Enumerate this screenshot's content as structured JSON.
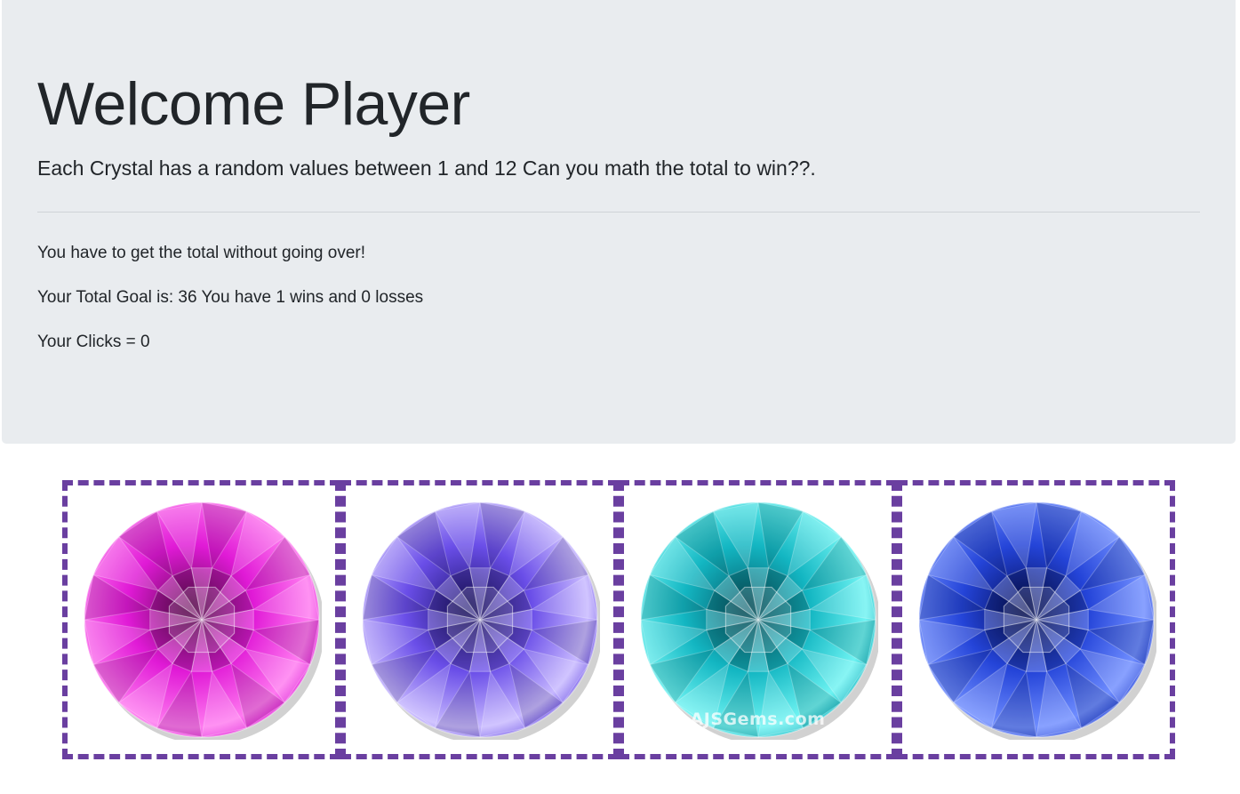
{
  "header": {
    "title": "Welcome Player",
    "subtitle": "Each Crystal has a random values between 1 and 12 Can you math the total to win??."
  },
  "info": {
    "rules": "You have to get the total without going over!",
    "stats": "Your Total Goal is: 36 You have 1 wins and 0 losses",
    "clicks": "Your Clicks = 0"
  },
  "crystals": [
    {
      "name": "pink-crystal",
      "color_light": "#ff7af0",
      "color_mid": "#e01ad6",
      "color_dark": "#6a0a5a"
    },
    {
      "name": "purple-crystal",
      "color_light": "#c7b8ff",
      "color_mid": "#6a4ee8",
      "color_dark": "#1e1470"
    },
    {
      "name": "teal-crystal",
      "color_light": "#6ef3f2",
      "color_mid": "#13b6c2",
      "color_dark": "#055c6a",
      "watermark": "AJSGems.com"
    },
    {
      "name": "blue-crystal",
      "color_light": "#6f8dff",
      "color_mid": "#2444d8",
      "color_dark": "#050f5c"
    }
  ],
  "colors": {
    "jumbotron_bg": "#e9ecef",
    "crystal_border": "#6a3fa0"
  }
}
